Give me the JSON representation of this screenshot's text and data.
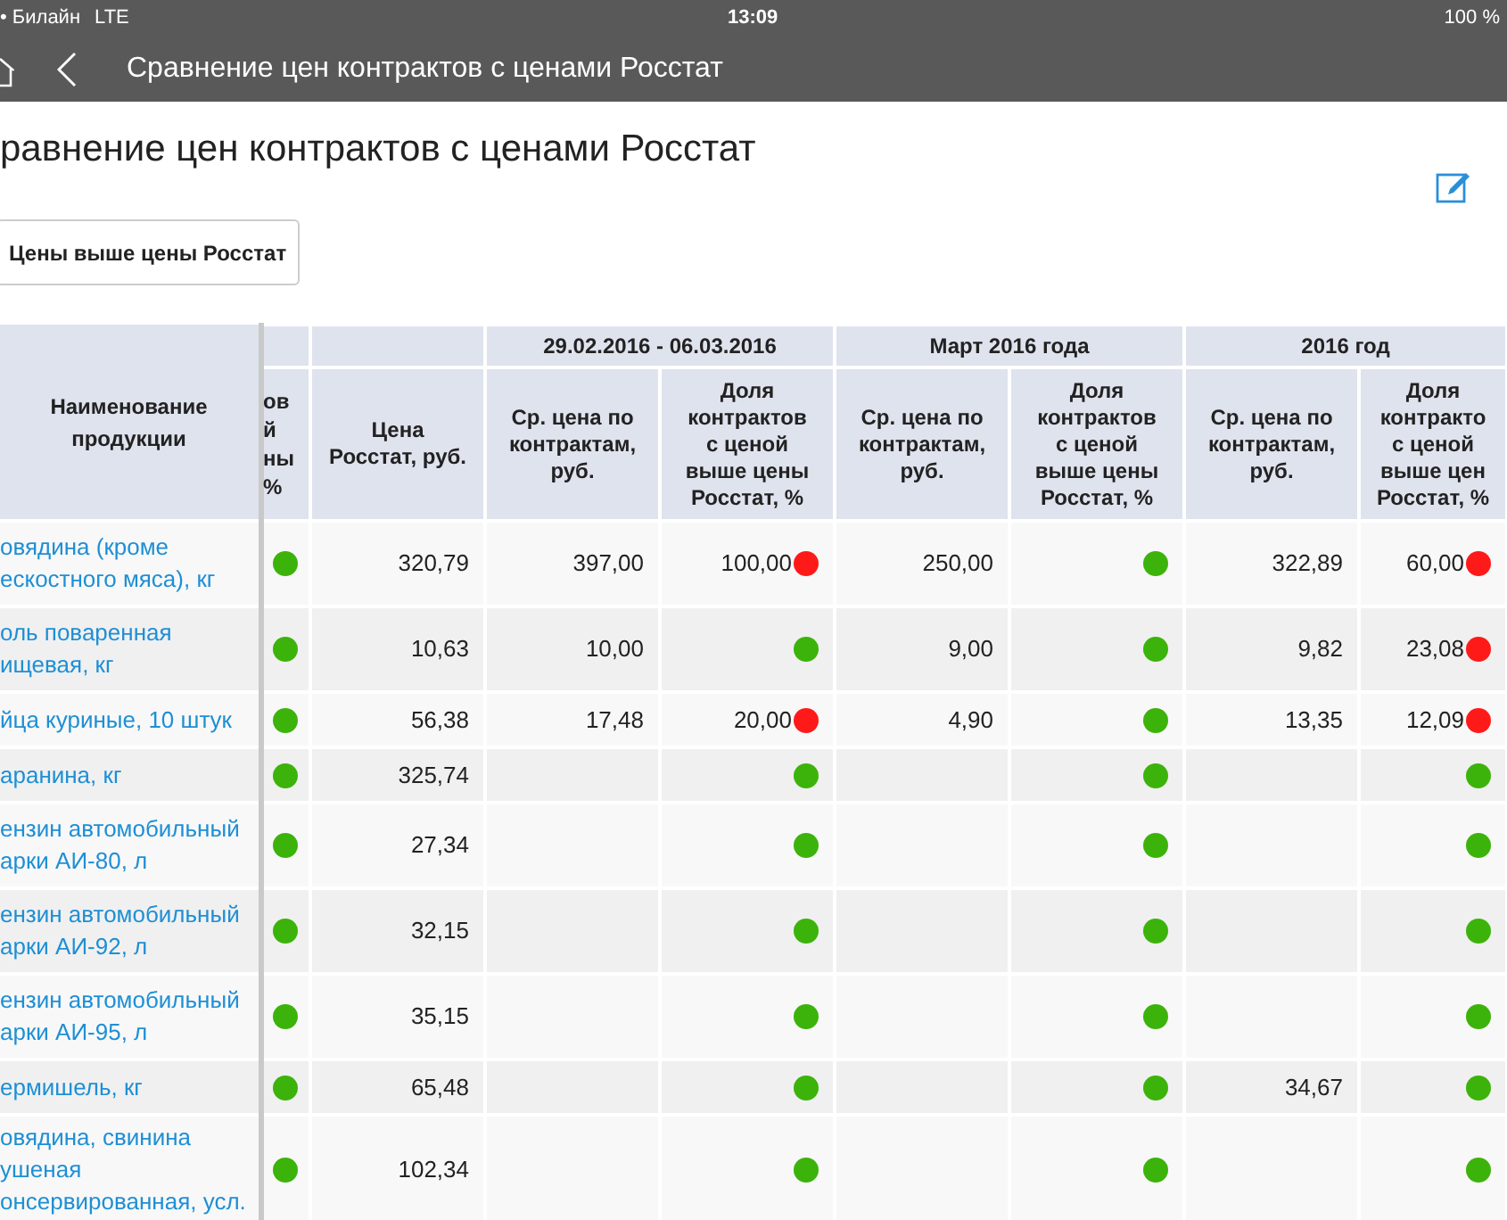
{
  "status_bar": {
    "carrier": "• Билайн",
    "network": "LTE",
    "time": "13:09",
    "battery": "100 %"
  },
  "nav_bar": {
    "title": "Сравнение цен контрактов с ценами Росстат"
  },
  "page_title": "равнение цен контрактов с ценами Росстат",
  "filter_button": "Цены выше цены Росстат",
  "table": {
    "name_header": "Наименование продукции",
    "column_2_header": [
      "ов",
      "й",
      "ны",
      "%"
    ],
    "rosstat_header": [
      "Цена",
      "Росстат, руб."
    ],
    "periods": [
      {
        "title": "29.02.2016 - 06.03.2016",
        "avg_header": [
          "Ср. цена по",
          "контрактам,",
          "руб."
        ],
        "share_header": [
          "Доля",
          "контрактов",
          "с ценой",
          "выше цены",
          "Росстат, %"
        ]
      },
      {
        "title": "Март 2016 года",
        "avg_header": [
          "Ср. цена по",
          "контрактам,",
          "руб."
        ],
        "share_header": [
          "Доля",
          "контрактов",
          "с ценой",
          "выше цены",
          "Росстат, %"
        ]
      },
      {
        "title": "2016 год",
        "avg_header": [
          "Ср. цена по",
          "контрактам,",
          "руб."
        ],
        "share_header": [
          "Доля",
          "контракто",
          "с ценой",
          "выше цен",
          "Росстат, %"
        ]
      }
    ],
    "rows": [
      {
        "name": [
          "овядина (кроме",
          "ескостного мяса), кг"
        ],
        "color": "#3cb30a",
        "rosstat": "320,79",
        "periods": [
          {
            "avg": "397,00",
            "share": "100,00",
            "color": "#ff1a1a"
          },
          {
            "avg": "250,00",
            "color": "#3cb30a"
          },
          {
            "avg": "322,89",
            "share": "60,00",
            "color": "#ff1a1a"
          }
        ]
      },
      {
        "name": [
          "оль поваренная",
          "ищевая, кг"
        ],
        "color": "#3cb30a",
        "rosstat": "10,63",
        "periods": [
          {
            "avg": "10,00",
            "color": "#3cb30a"
          },
          {
            "avg": "9,00",
            "color": "#3cb30a"
          },
          {
            "avg": "9,82",
            "share": "23,08",
            "color": "#ff1a1a"
          }
        ]
      },
      {
        "name": [
          "йца куриные, 10 штук"
        ],
        "color": "#3cb30a",
        "rosstat": "56,38",
        "periods": [
          {
            "avg": "17,48",
            "share": "20,00",
            "color": "#ff1a1a"
          },
          {
            "avg": "4,90",
            "color": "#3cb30a"
          },
          {
            "avg": "13,35",
            "share": "12,09",
            "color": "#ff1a1a"
          }
        ]
      },
      {
        "name": [
          "аранина, кг"
        ],
        "color": "#3cb30a",
        "rosstat": "325,74",
        "periods": [
          {
            "color": "#3cb30a"
          },
          {
            "color": "#3cb30a"
          },
          {
            "color": "#3cb30a"
          }
        ]
      },
      {
        "name": [
          "ензин автомобильный",
          "арки АИ-80, л"
        ],
        "color": "#3cb30a",
        "rosstat": "27,34",
        "periods": [
          {
            "color": "#3cb30a"
          },
          {
            "color": "#3cb30a"
          },
          {
            "color": "#3cb30a"
          }
        ]
      },
      {
        "name": [
          "ензин автомобильный",
          "арки АИ-92, л"
        ],
        "color": "#3cb30a",
        "rosstat": "32,15",
        "periods": [
          {
            "color": "#3cb30a"
          },
          {
            "color": "#3cb30a"
          },
          {
            "color": "#3cb30a"
          }
        ]
      },
      {
        "name": [
          "ензин автомобильный",
          "арки АИ-95, л"
        ],
        "color": "#3cb30a",
        "rosstat": "35,15",
        "periods": [
          {
            "color": "#3cb30a"
          },
          {
            "color": "#3cb30a"
          },
          {
            "color": "#3cb30a"
          }
        ]
      },
      {
        "name": [
          "ермишель, кг"
        ],
        "color": "#3cb30a",
        "rosstat": "65,48",
        "periods": [
          {
            "color": "#3cb30a"
          },
          {
            "color": "#3cb30a"
          },
          {
            "avg": "34,67",
            "color": "#3cb30a"
          }
        ]
      },
      {
        "name": [
          "овядина, свинина",
          "ушеная",
          "онсервированная, усл."
        ],
        "color": "#3cb30a",
        "rosstat": "102,34",
        "periods": [
          {
            "color": "#3cb30a"
          },
          {
            "color": "#3cb30a"
          },
          {
            "color": "#3cb30a"
          }
        ]
      }
    ]
  }
}
